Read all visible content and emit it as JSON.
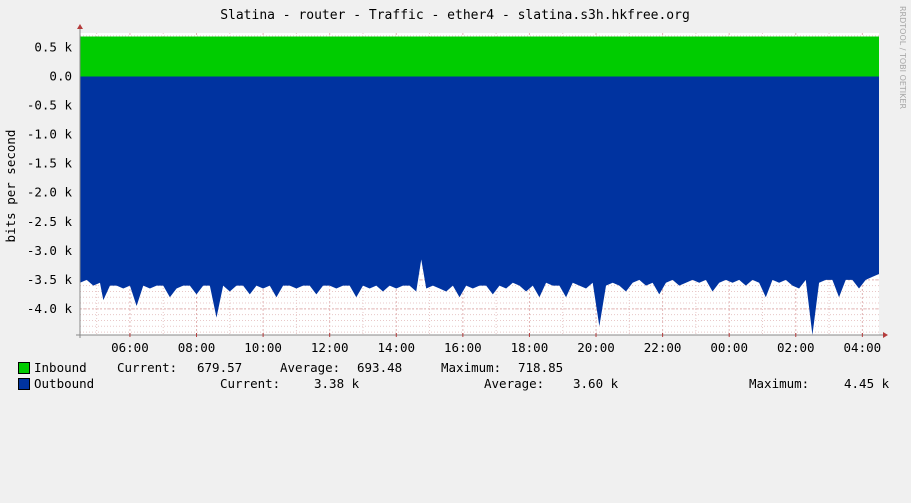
{
  "chart_data": {
    "type": "area",
    "title": "Slatina - router - Traffic - ether4 - slatina.s3h.hkfree.org",
    "ylabel": "bits per second",
    "xlabel": "",
    "y_tick_labels": [
      "0.5 k",
      "0.0",
      "-0.5 k",
      "-1.0 k",
      "-1.5 k",
      "-2.0 k",
      "-2.5 k",
      "-3.0 k",
      "-3.5 k",
      "-4.0 k"
    ],
    "y_tick_values": [
      500,
      0,
      -500,
      -1000,
      -1500,
      -2000,
      -2500,
      -3000,
      -3500,
      -4000
    ],
    "x_tick_labels": [
      "06:00",
      "08:00",
      "10:00",
      "12:00",
      "14:00",
      "16:00",
      "18:00",
      "20:00",
      "22:00",
      "00:00",
      "02:00",
      "04:00"
    ],
    "x_tick_hours": [
      6,
      8,
      10,
      12,
      14,
      16,
      18,
      20,
      22,
      24,
      26,
      28
    ],
    "xlim_hours": [
      4.5,
      28.5
    ],
    "ylim": [
      -4450,
      750
    ],
    "grid": true,
    "series": [
      {
        "name": "Inbound",
        "color": "#00cc00",
        "x_hours": [
          4.5,
          28.5
        ],
        "values": [
          690,
          690
        ]
      },
      {
        "name": "Outbound",
        "color": "#0033a0",
        "x_hours": [
          4.5,
          4.7,
          4.9,
          5.1,
          5.2,
          5.4,
          5.6,
          5.8,
          6.0,
          6.2,
          6.4,
          6.6,
          6.8,
          7.0,
          7.2,
          7.4,
          7.6,
          7.8,
          8.0,
          8.2,
          8.4,
          8.6,
          8.8,
          9.0,
          9.2,
          9.4,
          9.6,
          9.8,
          10.0,
          10.2,
          10.4,
          10.6,
          10.8,
          11.0,
          11.2,
          11.4,
          11.6,
          11.8,
          12.0,
          12.2,
          12.4,
          12.6,
          12.8,
          13.0,
          13.2,
          13.4,
          13.6,
          13.8,
          14.0,
          14.2,
          14.4,
          14.6,
          14.75,
          14.9,
          15.1,
          15.3,
          15.5,
          15.7,
          15.9,
          16.1,
          16.3,
          16.5,
          16.7,
          16.9,
          17.1,
          17.3,
          17.5,
          17.7,
          17.9,
          18.1,
          18.3,
          18.5,
          18.7,
          18.9,
          19.1,
          19.3,
          19.5,
          19.7,
          19.9,
          20.1,
          20.3,
          20.5,
          20.7,
          20.9,
          21.1,
          21.3,
          21.5,
          21.7,
          21.9,
          22.1,
          22.3,
          22.5,
          22.7,
          22.9,
          23.1,
          23.3,
          23.5,
          23.7,
          23.9,
          24.1,
          24.3,
          24.5,
          24.7,
          24.9,
          25.1,
          25.3,
          25.5,
          25.7,
          25.9,
          26.1,
          26.3,
          26.5,
          26.7,
          26.9,
          27.1,
          27.3,
          27.5,
          27.7,
          27.9,
          28.1,
          28.3,
          28.5
        ],
        "values": [
          -3550,
          -3500,
          -3600,
          -3550,
          -3850,
          -3600,
          -3600,
          -3650,
          -3600,
          -3950,
          -3600,
          -3650,
          -3600,
          -3600,
          -3800,
          -3650,
          -3600,
          -3600,
          -3750,
          -3600,
          -3600,
          -4150,
          -3600,
          -3700,
          -3600,
          -3600,
          -3750,
          -3600,
          -3650,
          -3600,
          -3800,
          -3600,
          -3600,
          -3650,
          -3600,
          -3600,
          -3750,
          -3600,
          -3600,
          -3650,
          -3600,
          -3600,
          -3800,
          -3600,
          -3650,
          -3600,
          -3700,
          -3600,
          -3650,
          -3600,
          -3600,
          -3700,
          -3150,
          -3650,
          -3600,
          -3650,
          -3700,
          -3600,
          -3800,
          -3600,
          -3650,
          -3600,
          -3600,
          -3750,
          -3600,
          -3650,
          -3550,
          -3600,
          -3700,
          -3600,
          -3800,
          -3550,
          -3600,
          -3600,
          -3800,
          -3550,
          -3600,
          -3650,
          -3550,
          -4300,
          -3600,
          -3550,
          -3600,
          -3700,
          -3550,
          -3500,
          -3600,
          -3550,
          -3750,
          -3550,
          -3500,
          -3600,
          -3550,
          -3500,
          -3550,
          -3500,
          -3700,
          -3550,
          -3500,
          -3550,
          -3500,
          -3600,
          -3500,
          -3550,
          -3800,
          -3500,
          -3550,
          -3500,
          -3600,
          -3650,
          -3500,
          -4450,
          -3550,
          -3500,
          -3500,
          -3800,
          -3500,
          -3500,
          -3650,
          -3500,
          -3450,
          -3400
        ]
      }
    ]
  },
  "legend": {
    "inbound": {
      "label": "Inbound",
      "current_label": "Current:",
      "current": "679.57",
      "average_label": "Average:",
      "average": "693.48",
      "maximum_label": "Maximum:",
      "maximum": "718.85"
    },
    "outbound": {
      "label": "Outbound",
      "current_label": "Current:",
      "current": "3.38 k",
      "average_label": "Average:",
      "average": "3.60 k",
      "maximum_label": "Maximum:",
      "maximum": "4.45 k"
    }
  },
  "credit": "RRDTOOL / TOBI OETIKER",
  "colors": {
    "background": "#f0f0f0",
    "canvas": "#ffffff",
    "grid_minor": "#e8c8c8",
    "grid_major": "#e2b4b4",
    "axis_arrow": "#b43c3c"
  }
}
